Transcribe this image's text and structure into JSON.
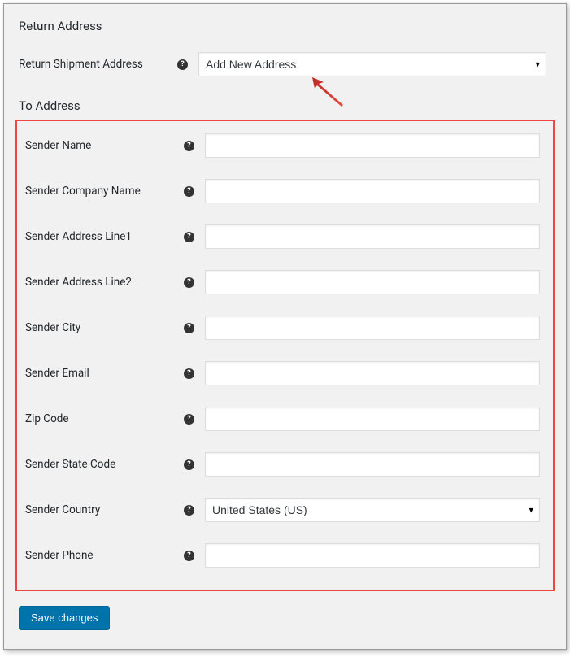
{
  "sections": {
    "return_address_title": "Return Address",
    "to_address_title": "To Address"
  },
  "return_shipment": {
    "label": "Return Shipment Address",
    "selected": "Add New Address"
  },
  "help_icon_text": "?",
  "fields": {
    "sender_name": {
      "label": "Sender Name",
      "value": ""
    },
    "sender_company": {
      "label": "Sender Company Name",
      "value": ""
    },
    "sender_addr1": {
      "label": "Sender Address Line1",
      "value": ""
    },
    "sender_addr2": {
      "label": "Sender Address Line2",
      "value": ""
    },
    "sender_city": {
      "label": "Sender City",
      "value": ""
    },
    "sender_email": {
      "label": "Sender Email",
      "value": ""
    },
    "zip_code": {
      "label": "Zip Code",
      "value": ""
    },
    "sender_state": {
      "label": "Sender State Code",
      "value": ""
    },
    "sender_country": {
      "label": "Sender Country",
      "selected": "United States (US)"
    },
    "sender_phone": {
      "label": "Sender Phone",
      "value": ""
    }
  },
  "buttons": {
    "save": "Save changes"
  }
}
